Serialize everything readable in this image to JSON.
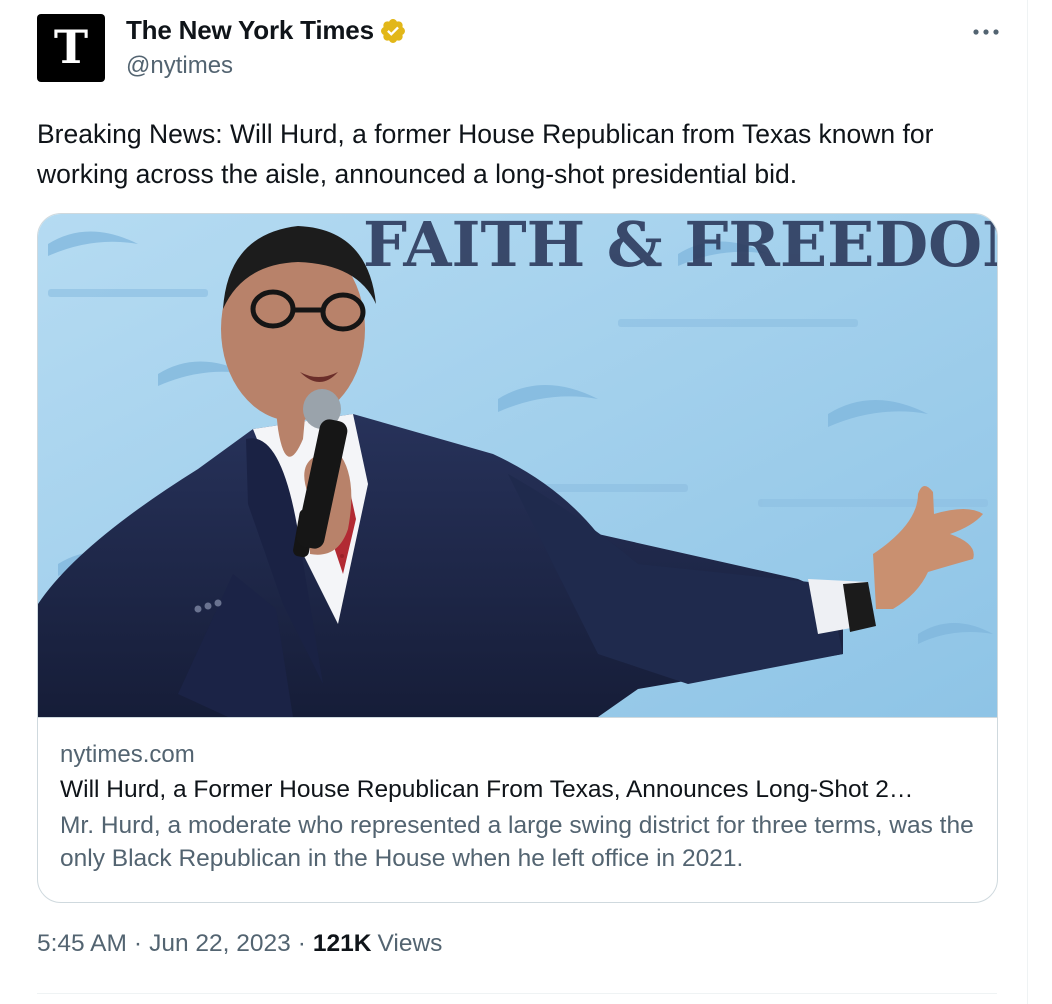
{
  "author": {
    "display_name": "The New York Times",
    "handle": "@nytimes",
    "avatar_glyph": "T",
    "verified": true,
    "verified_color": "#e2b719"
  },
  "tweet": {
    "text": "Breaking News: Will Hurd, a former House Republican from Texas known for working across the aisle, announced a long-shot presidential bid."
  },
  "card": {
    "image_backdrop_text": "FAITH & FREEDOM C",
    "domain": "nytimes.com",
    "title": "Will Hurd, a Former House Republican From Texas, Announces Long-Shot 2…",
    "description": "Mr. Hurd, a moderate who represented a large swing district for three terms, was the only Black Republican in the House when he left office in 2021."
  },
  "meta": {
    "time": "5:45 AM",
    "separator": "·",
    "date": "Jun 22, 2023",
    "views_count": "121K",
    "views_label": "Views"
  },
  "colors": {
    "text_primary": "#0f1419",
    "text_secondary": "#536471",
    "border": "#cfd9de",
    "backdrop_blue": "#a9d3ee"
  }
}
